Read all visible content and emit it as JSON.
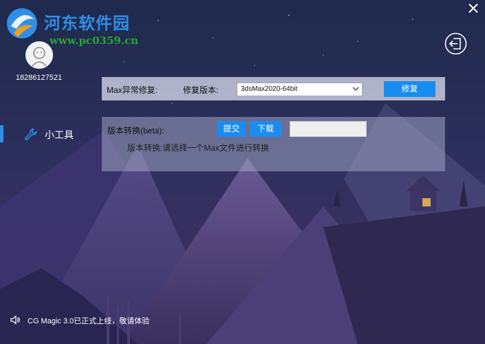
{
  "watermark": {
    "title": "河东软件园",
    "url": "www.pc0359.cn"
  },
  "user": {
    "name": "18286127521",
    "avatar_icon": "user-avatar-icon"
  },
  "window": {
    "close_icon": "close-icon",
    "logout_icon": "logout-icon"
  },
  "sidebar": {
    "items": [
      {
        "label": "小工具",
        "icon": "wrench-icon",
        "active": true
      }
    ]
  },
  "repair": {
    "label": "Max异常修复:",
    "version_label": "修复版本:",
    "selected_version": "3dsMax2020-64bit",
    "button": "修复"
  },
  "convert": {
    "label": "版本转换(beta):",
    "submit_button": "提交",
    "download_button": "下载",
    "hint": "版本转换:请选择一个Max文件进行转换"
  },
  "notice": {
    "icon": "speaker-icon",
    "text": "CG Magic 3.0已正式上线，敬请体验"
  },
  "colors": {
    "accent": "#1a8cf0",
    "background_top": "#1f2a4d",
    "background_bottom": "#2a2048"
  }
}
